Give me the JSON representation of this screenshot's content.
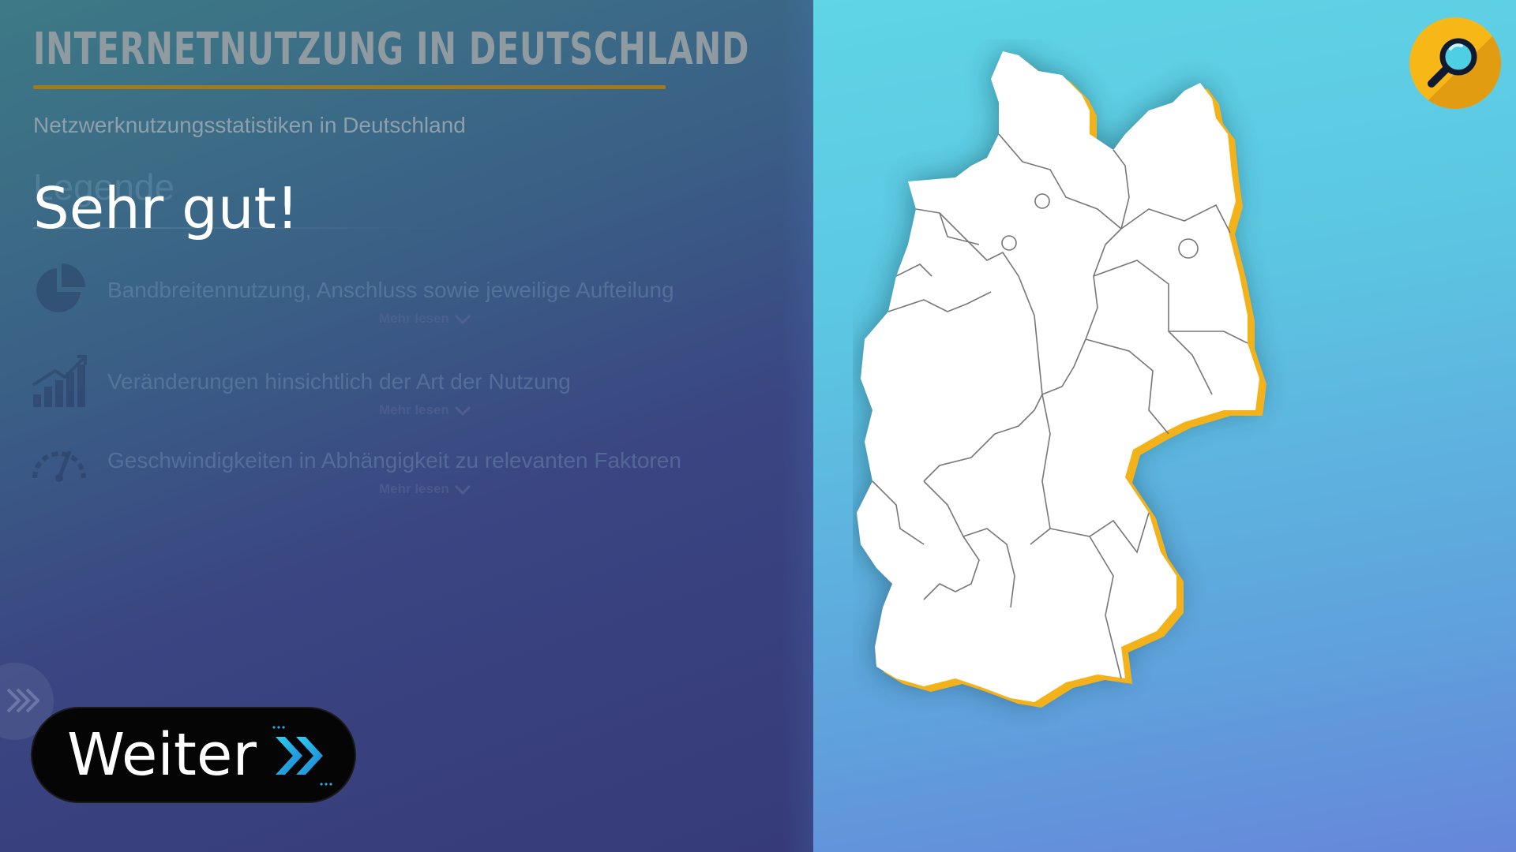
{
  "header": {
    "title": "INTERNETNUTZUNG IN DEUTSCHLAND",
    "subtitle": "Netzwerknutzungsstatistiken in Deutschland"
  },
  "legend": {
    "heading": "Legende",
    "items": [
      {
        "icon": "pie-chart-icon",
        "text": "Bandbreitennutzung, Anschluss sowie jeweilige Aufteilung",
        "more": "Mehr lesen"
      },
      {
        "icon": "growth-chart-icon",
        "text": "Veränderungen hinsichtlich der Art der Nutzung",
        "more": "Mehr lesen"
      },
      {
        "icon": "speedometer-icon",
        "text": "Geschwindigkeiten in Abhängigkeit zu relevanten Faktoren",
        "more": "Mehr lesen"
      }
    ]
  },
  "feedback": {
    "message": "Sehr gut!"
  },
  "navigation": {
    "next_label": "Weiter",
    "next_icon": "double-chevron-right-icon",
    "side_toggle_icon": "double-chevron-right-icon"
  },
  "tools": {
    "search_icon": "magnifier-icon"
  },
  "map": {
    "name": "germany-states-map",
    "fill": "#ffffff",
    "border_color": "#f3b21a",
    "state_line_color": "#777777"
  },
  "colors": {
    "accent_gold": "#a47a18",
    "search_bg": "#f7b817",
    "next_bg": "#050505",
    "chevron_cyan": "#22c7e6"
  }
}
